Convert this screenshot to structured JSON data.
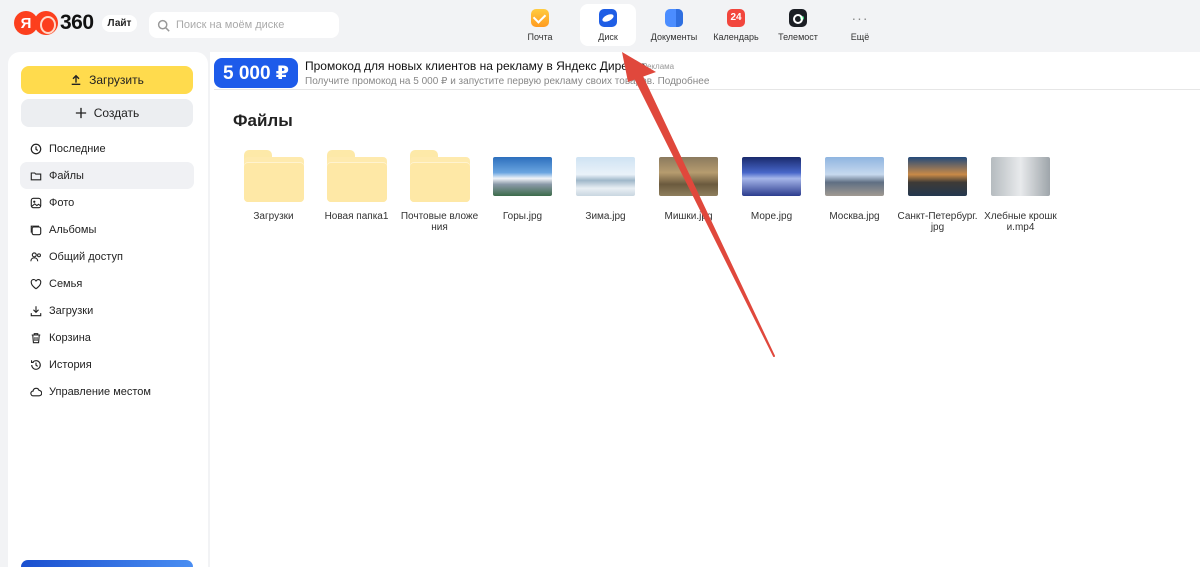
{
  "header": {
    "logo_letter": "Я",
    "logo_number": "360",
    "logo_badge": "Лайт",
    "search_placeholder": "Поиск на моём диске",
    "services": [
      {
        "label": "Почта",
        "icon": "mail-icon"
      },
      {
        "label": "Диск",
        "icon": "disk-icon",
        "active": true
      },
      {
        "label": "Документы",
        "icon": "documents-icon"
      },
      {
        "label": "Календарь",
        "icon": "calendar-icon",
        "icon_text": "24"
      },
      {
        "label": "Телемост",
        "icon": "telemost-icon"
      },
      {
        "label": "Ещё",
        "icon": "more-icon",
        "icon_text": "···"
      }
    ]
  },
  "sidebar": {
    "upload_label": "Загрузить",
    "create_label": "Создать",
    "items": [
      {
        "label": "Последние",
        "icon": "clock-icon"
      },
      {
        "label": "Файлы",
        "icon": "folder-icon",
        "active": true
      },
      {
        "label": "Фото",
        "icon": "photo-icon"
      },
      {
        "label": "Альбомы",
        "icon": "album-icon"
      },
      {
        "label": "Общий доступ",
        "icon": "shared-icon"
      },
      {
        "label": "Семья",
        "icon": "family-icon"
      },
      {
        "label": "Загрузки",
        "icon": "download-icon"
      },
      {
        "label": "Корзина",
        "icon": "trash-icon"
      },
      {
        "label": "История",
        "icon": "history-icon"
      },
      {
        "label": "Управление местом",
        "icon": "cloud-icon"
      }
    ]
  },
  "banner": {
    "badge": "5 000 ₽",
    "title": "Промокод для новых клиентов на рекламу в Яндекс Директе",
    "tag": "Реклама",
    "subtitle": "Получите промокод на 5 000 ₽ и запустите первую рекламу своих товаров. Подробнее"
  },
  "main": {
    "title": "Файлы",
    "files": [
      {
        "name": "Загрузки",
        "type": "folder"
      },
      {
        "name": "Новая папка1",
        "type": "folder"
      },
      {
        "name": "Почтовые вложения",
        "type": "folder"
      },
      {
        "name": "Горы.jpg",
        "type": "image",
        "thumb": "mountains"
      },
      {
        "name": "Зима.jpg",
        "type": "image",
        "thumb": "winter"
      },
      {
        "name": "Мишки.jpg",
        "type": "image",
        "thumb": "bears"
      },
      {
        "name": "Море.jpg",
        "type": "image",
        "thumb": "sea"
      },
      {
        "name": "Москва.jpg",
        "type": "image",
        "thumb": "moscow"
      },
      {
        "name": "Санкт-Петербург.jpg",
        "type": "image",
        "thumb": "spb"
      },
      {
        "name": "Хлебные крошки.mp4",
        "type": "video",
        "thumb": "video"
      }
    ]
  },
  "colors": {
    "accent_yellow": "#ffdb4d",
    "banner_blue": "#1d5bea",
    "annotation_arrow": "#e0483c"
  }
}
